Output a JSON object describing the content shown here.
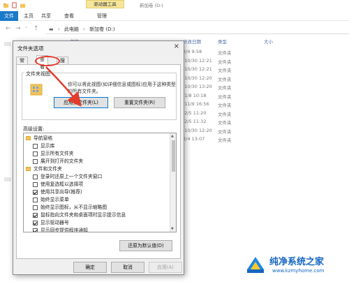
{
  "titlebar": {
    "tool_tab": "驱动器工具",
    "title": "新加卷 (D:)"
  },
  "ribbon": {
    "tabs": [
      "文件",
      "主页",
      "共享",
      "查看",
      "管理"
    ]
  },
  "address": {
    "crumbs": [
      "此电脑",
      "新加卷 (D:)"
    ]
  },
  "file_list": {
    "headers": {
      "name": "名称",
      "date": "修改日期",
      "type": "类型",
      "size": "大小"
    },
    "rows": [
      {
        "date": "2/4 9:58",
        "type": "文件夹"
      },
      {
        "date": "/10/30 12:21",
        "type": "文件夹"
      },
      {
        "date": "/10/30 12:21",
        "type": "文件夹"
      },
      {
        "date": "/10/30 12:20",
        "type": "文件夹"
      },
      {
        "date": "/10/30 13:20",
        "type": "文件夹"
      },
      {
        "date": "/1/8 10:18",
        "type": "文件夹"
      },
      {
        "date": "/11/9 16:56",
        "type": "文件夹"
      },
      {
        "date": "/2/5 11:20",
        "type": "文件夹"
      },
      {
        "date": "/2/5 11:32",
        "type": "文件夹"
      },
      {
        "date": "/10/30 12:20",
        "type": "文件夹"
      },
      {
        "date": "2/4 13:07",
        "type": "文件夹"
      }
    ]
  },
  "dialog": {
    "title": "文件夹选项",
    "close": "×",
    "tabs": [
      "常规",
      "查看",
      "搜索"
    ],
    "folder_view": {
      "label": "文件夹视图",
      "description": "你可以将此视图(如详细信息或图标)应用于这种类型的所有文件夹。",
      "apply_button": "应用到文件夹(L)",
      "reset_button": "重置文件夹(R)"
    },
    "advanced": {
      "label": "高级设置:",
      "items": [
        {
          "kind": "folder",
          "label": "导航窗格"
        },
        {
          "kind": "check",
          "label": "显示库",
          "checked": false,
          "indent": 1
        },
        {
          "kind": "check",
          "label": "显示所有文件夹",
          "checked": false,
          "indent": 1
        },
        {
          "kind": "check",
          "label": "展开到打开的文件夹",
          "checked": false,
          "indent": 1
        },
        {
          "kind": "folder",
          "label": "文件和文件夹"
        },
        {
          "kind": "check",
          "label": "登录时还原上一个文件夹窗口",
          "checked": false,
          "indent": 1
        },
        {
          "kind": "check",
          "label": "使用复选框以选择项",
          "checked": false,
          "indent": 1
        },
        {
          "kind": "check",
          "label": "使用共享向导(推荐)",
          "checked": true,
          "indent": 1
        },
        {
          "kind": "check",
          "label": "始终显示菜单",
          "checked": false,
          "indent": 1
        },
        {
          "kind": "check",
          "label": "始终显示图标，从不显示缩略图",
          "checked": false,
          "indent": 1
        },
        {
          "kind": "check",
          "label": "鼠标指向文件夹和桌面项时显示提示信息",
          "checked": true,
          "indent": 1
        },
        {
          "kind": "check",
          "label": "显示驱动器号",
          "checked": true,
          "indent": 1
        },
        {
          "kind": "check",
          "label": "显示同步提供程序通知",
          "checked": true,
          "indent": 1
        }
      ]
    },
    "restore_button": "还原为默认值(D)",
    "ok_button": "确定",
    "cancel_button": "取消",
    "apply_button": "应用(A)"
  },
  "watermark": {
    "title": "纯净系统之家",
    "url": "www.kzmyhome.com"
  },
  "colors": {
    "accent": "#1979ca",
    "highlight": "#e43b2b",
    "tool_tab": "#f6e69b"
  }
}
